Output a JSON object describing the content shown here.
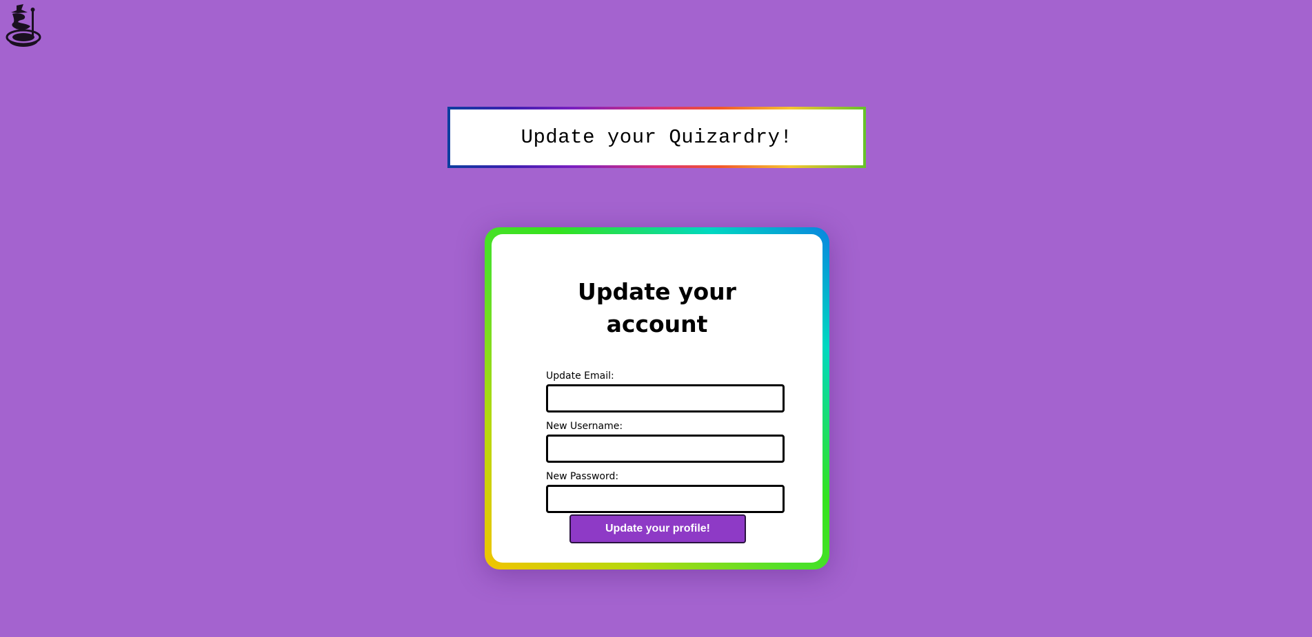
{
  "logo": {
    "icon": "wizard-logo-icon"
  },
  "banner": {
    "title": "Update your Quizardry!"
  },
  "form": {
    "title": "Update your account",
    "email": {
      "label": "Update Email:",
      "value": "",
      "placeholder": ""
    },
    "username": {
      "label": "New Username:",
      "value": "",
      "placeholder": ""
    },
    "password": {
      "label": "New Password:",
      "value": "",
      "placeholder": ""
    },
    "submit_label": "Update your profile!"
  },
  "colors": {
    "background": "#a463cf",
    "button": "#8e3ac6",
    "card": "#ffffff"
  }
}
